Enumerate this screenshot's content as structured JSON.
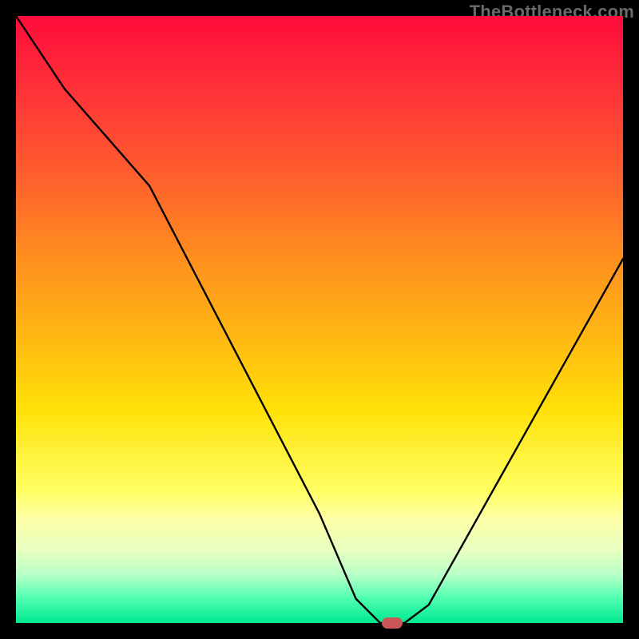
{
  "watermark": "TheBottleneck.com",
  "chart_data": {
    "type": "line",
    "title": "",
    "xlabel": "",
    "ylabel": "",
    "xlim": [
      0,
      100
    ],
    "ylim": [
      0,
      100
    ],
    "x": [
      0,
      8,
      22,
      50,
      56,
      60,
      64,
      68,
      100
    ],
    "values": [
      100,
      88,
      72,
      18,
      4,
      0,
      0,
      3,
      60
    ],
    "marker": {
      "x": 62,
      "y": 0
    },
    "background_gradient": [
      "#ff0b3a",
      "#ffe108",
      "#00e890"
    ]
  }
}
